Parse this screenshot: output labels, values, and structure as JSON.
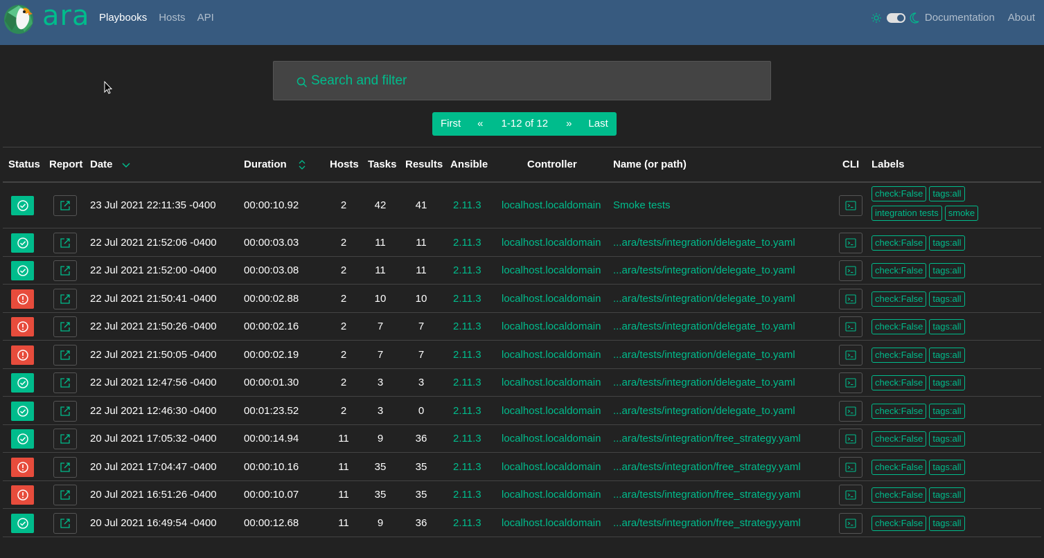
{
  "nav": {
    "brand": "ara",
    "links": [
      "Playbooks",
      "Hosts",
      "API"
    ],
    "active": "Playbooks",
    "documentation": "Documentation",
    "about": "About"
  },
  "search": {
    "placeholder": "Search and filter"
  },
  "pagination": {
    "first": "First",
    "prev": "«",
    "range": "1-12 of 12",
    "next": "»",
    "last": "Last"
  },
  "columns": {
    "status": "Status",
    "report": "Report",
    "date": "Date",
    "duration": "Duration",
    "hosts": "Hosts",
    "tasks": "Tasks",
    "results": "Results",
    "ansible": "Ansible",
    "controller": "Controller",
    "name": "Name (or path)",
    "cli": "CLI",
    "labels": "Labels"
  },
  "colors": {
    "accent": "#00bc8c",
    "failed": "#e74c3c",
    "navbar": "#375a7f",
    "background": "#222222"
  },
  "rows": [
    {
      "status": "completed",
      "date": "23 Jul 2021 22:11:35 -0400",
      "duration": "00:00:10.92",
      "hosts": "2",
      "tasks": "42",
      "results": "41",
      "ansible": "2.11.3",
      "controller": "localhost.localdomain",
      "name": "Smoke tests",
      "labels": [
        "check:False",
        "tags:all",
        "integration tests",
        "smoke"
      ]
    },
    {
      "status": "completed",
      "date": "22 Jul 2021 21:52:06 -0400",
      "duration": "00:00:03.03",
      "hosts": "2",
      "tasks": "11",
      "results": "11",
      "ansible": "2.11.3",
      "controller": "localhost.localdomain",
      "name": "...ara/tests/integration/delegate_to.yaml",
      "labels": [
        "check:False",
        "tags:all"
      ]
    },
    {
      "status": "completed",
      "date": "22 Jul 2021 21:52:00 -0400",
      "duration": "00:00:03.08",
      "hosts": "2",
      "tasks": "11",
      "results": "11",
      "ansible": "2.11.3",
      "controller": "localhost.localdomain",
      "name": "...ara/tests/integration/delegate_to.yaml",
      "labels": [
        "check:False",
        "tags:all"
      ]
    },
    {
      "status": "failed",
      "date": "22 Jul 2021 21:50:41 -0400",
      "duration": "00:00:02.88",
      "hosts": "2",
      "tasks": "10",
      "results": "10",
      "ansible": "2.11.3",
      "controller": "localhost.localdomain",
      "name": "...ara/tests/integration/delegate_to.yaml",
      "labels": [
        "check:False",
        "tags:all"
      ]
    },
    {
      "status": "failed",
      "date": "22 Jul 2021 21:50:26 -0400",
      "duration": "00:00:02.16",
      "hosts": "2",
      "tasks": "7",
      "results": "7",
      "ansible": "2.11.3",
      "controller": "localhost.localdomain",
      "name": "...ara/tests/integration/delegate_to.yaml",
      "labels": [
        "check:False",
        "tags:all"
      ]
    },
    {
      "status": "failed",
      "date": "22 Jul 2021 21:50:05 -0400",
      "duration": "00:00:02.19",
      "hosts": "2",
      "tasks": "7",
      "results": "7",
      "ansible": "2.11.3",
      "controller": "localhost.localdomain",
      "name": "...ara/tests/integration/delegate_to.yaml",
      "labels": [
        "check:False",
        "tags:all"
      ]
    },
    {
      "status": "completed",
      "date": "22 Jul 2021 12:47:56 -0400",
      "duration": "00:00:01.30",
      "hosts": "2",
      "tasks": "3",
      "results": "3",
      "ansible": "2.11.3",
      "controller": "localhost.localdomain",
      "name": "...ara/tests/integration/delegate_to.yaml",
      "labels": [
        "check:False",
        "tags:all"
      ]
    },
    {
      "status": "completed",
      "date": "22 Jul 2021 12:46:30 -0400",
      "duration": "00:01:23.52",
      "hosts": "2",
      "tasks": "3",
      "results": "0",
      "ansible": "2.11.3",
      "controller": "localhost.localdomain",
      "name": "...ara/tests/integration/delegate_to.yaml",
      "labels": [
        "check:False",
        "tags:all"
      ]
    },
    {
      "status": "completed",
      "date": "20 Jul 2021 17:05:32 -0400",
      "duration": "00:00:14.94",
      "hosts": "11",
      "tasks": "9",
      "results": "36",
      "ansible": "2.11.3",
      "controller": "localhost.localdomain",
      "name": "...ara/tests/integration/free_strategy.yaml",
      "labels": [
        "check:False",
        "tags:all"
      ]
    },
    {
      "status": "failed",
      "date": "20 Jul 2021 17:04:47 -0400",
      "duration": "00:00:10.16",
      "hosts": "11",
      "tasks": "35",
      "results": "35",
      "ansible": "2.11.3",
      "controller": "localhost.localdomain",
      "name": "...ara/tests/integration/free_strategy.yaml",
      "labels": [
        "check:False",
        "tags:all"
      ]
    },
    {
      "status": "failed",
      "date": "20 Jul 2021 16:51:26 -0400",
      "duration": "00:00:10.07",
      "hosts": "11",
      "tasks": "35",
      "results": "35",
      "ansible": "2.11.3",
      "controller": "localhost.localdomain",
      "name": "...ara/tests/integration/free_strategy.yaml",
      "labels": [
        "check:False",
        "tags:all"
      ]
    },
    {
      "status": "completed",
      "date": "20 Jul 2021 16:49:54 -0400",
      "duration": "00:00:12.68",
      "hosts": "11",
      "tasks": "9",
      "results": "36",
      "ansible": "2.11.3",
      "controller": "localhost.localdomain",
      "name": "...ara/tests/integration/free_strategy.yaml",
      "labels": [
        "check:False",
        "tags:all"
      ]
    }
  ]
}
